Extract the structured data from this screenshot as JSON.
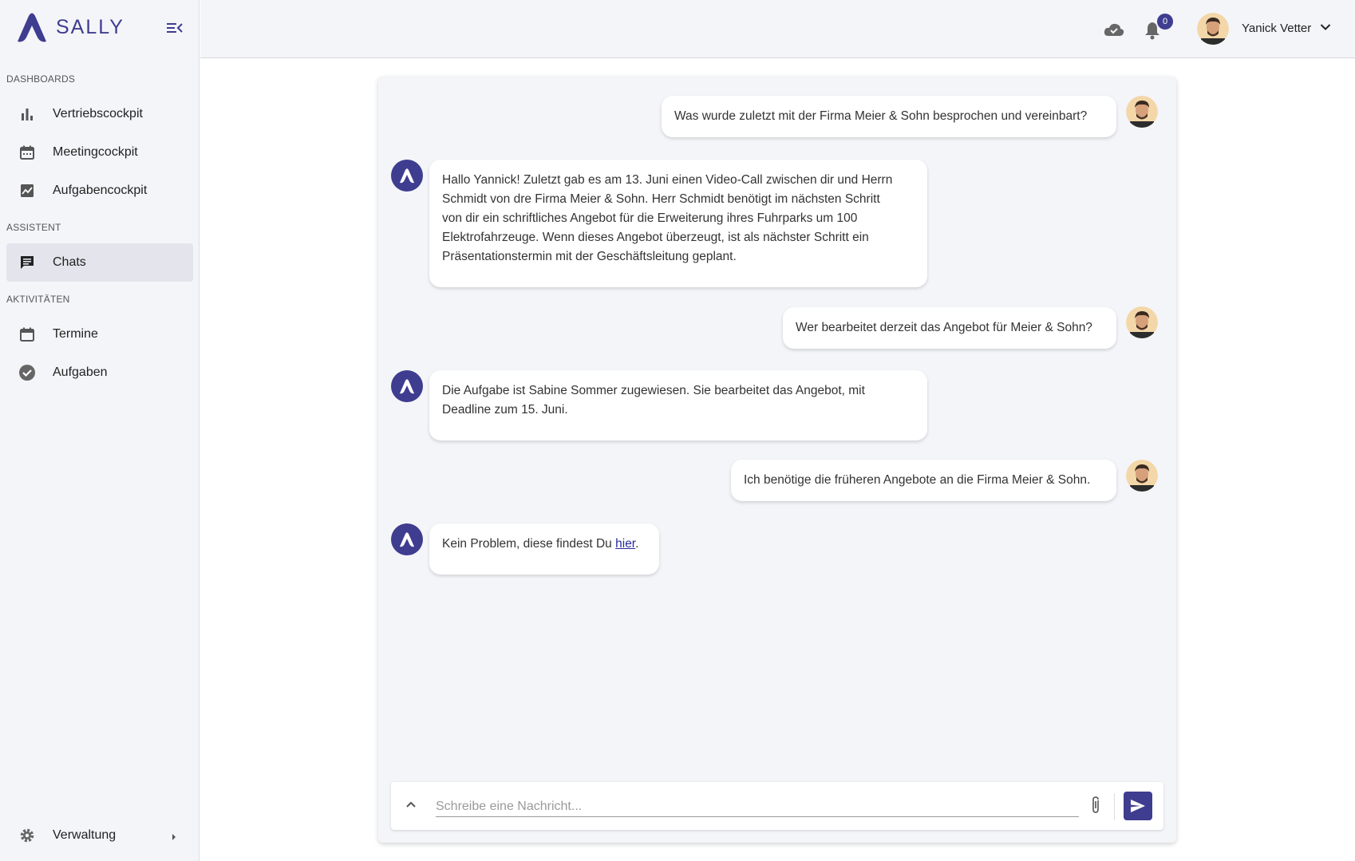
{
  "brand": {
    "name": "SALLY",
    "accent": "#3f3d8f"
  },
  "sidebar": {
    "sections": [
      {
        "label": "DASHBOARDS"
      },
      {
        "label": "ASSISTENT"
      },
      {
        "label": "AKTIVITÄTEN"
      }
    ],
    "items": [
      {
        "label": "Vertriebscockpit",
        "icon": "bar-chart-icon"
      },
      {
        "label": "Meetingcockpit",
        "icon": "calendar-icon"
      },
      {
        "label": "Aufgabencockpit",
        "icon": "trend-chart-icon"
      },
      {
        "label": "Chats",
        "icon": "chat-icon",
        "active": true
      },
      {
        "label": "Termine",
        "icon": "calendar-icon"
      },
      {
        "label": "Aufgaben",
        "icon": "check-circle-icon"
      }
    ],
    "footer": {
      "label": "Verwaltung",
      "icon": "gear-icon"
    }
  },
  "header": {
    "notifications_count": "0",
    "user_name": "Yanick Vetter"
  },
  "chat": {
    "messages": [
      {
        "from": "user",
        "text": "Was wurde zuletzt mit der Firma Meier & Sohn besprochen und vereinbart?"
      },
      {
        "from": "bot",
        "lines": [
          "Hallo Yannick! Zuletzt gab es am 13. Juni einen Video-Call zwischen dir und Herrn",
          "Schmidt von dre Firma Meier & Sohn. Herr Schmidt benötigt im nächsten Schritt",
          "von dir ein schriftliches Angebot für die Erweiterung ihres Fuhrparks um 100",
          "Elektrofahrzeuge. Wenn dieses Angebot überzeugt, ist als nächster Schritt ein",
          "Präsentationstermin mit der Geschäftsleitung geplant."
        ]
      },
      {
        "from": "user",
        "text": "Wer bearbeitet derzeit das Angebot für Meier & Sohn?"
      },
      {
        "from": "bot",
        "lines": [
          "Die Aufgabe ist Sabine Sommer zugewiesen. Sie bearbeitet das Angebot, mit",
          "Deadline zum 15. Juni."
        ]
      },
      {
        "from": "user",
        "text": "Ich benötige die früheren Angebote an die Firma Meier & Sohn."
      },
      {
        "from": "bot",
        "text_before": "Kein Problem, diese findest Du ",
        "link": "hier",
        "text_after": "."
      }
    ],
    "composer": {
      "placeholder": "Schreibe eine Nachricht..."
    }
  }
}
